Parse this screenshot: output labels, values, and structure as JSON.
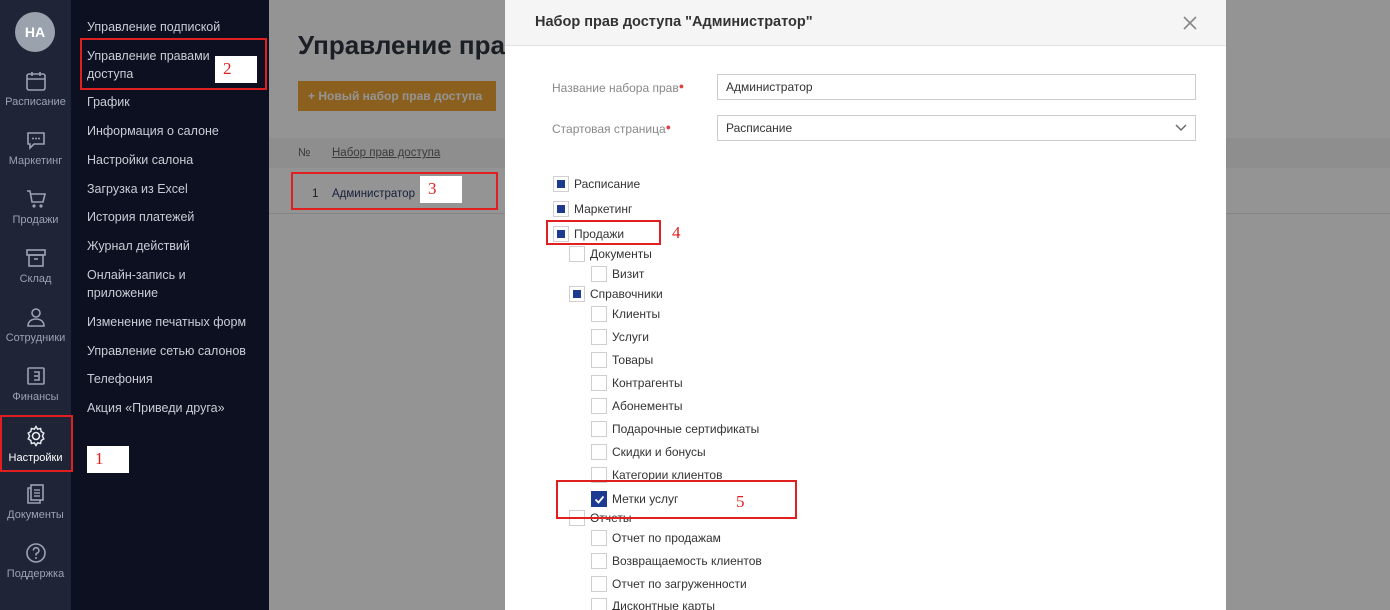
{
  "rail": {
    "avatar": "НА",
    "items": [
      {
        "label": "Расписание",
        "icon": "calendar-icon"
      },
      {
        "label": "Маркетинг",
        "icon": "chat-icon"
      },
      {
        "label": "Продажи",
        "icon": "cart-icon"
      },
      {
        "label": "Склад",
        "icon": "box-icon"
      },
      {
        "label": "Сотрудники",
        "icon": "person-icon"
      },
      {
        "label": "Финансы",
        "icon": "wallet-icon"
      },
      {
        "label": "Настройки",
        "icon": "gear-icon"
      },
      {
        "label": "Документы",
        "icon": "documents-icon"
      },
      {
        "label": "Поддержка",
        "icon": "help-icon"
      }
    ]
  },
  "submenu": {
    "items": [
      "Управление подпиской",
      "Управление правами доступа",
      "График",
      "Информация о салоне",
      "Настройки салона",
      "Загрузка из Excel",
      "История платежей",
      "Журнал действий",
      "Онлайн-запись и приложение",
      "Изменение печатных форм",
      "Управление сетью салонов",
      "Телефония",
      "Акция «Приведи друга»"
    ]
  },
  "page": {
    "title": "Управление прав",
    "new_button": "+ Новый набор прав доступа",
    "table": {
      "headers": [
        "№",
        "Набор прав доступа"
      ],
      "rows": [
        [
          "1",
          "Администратор"
        ]
      ]
    }
  },
  "modal": {
    "title": "Набор прав доступа \"Администратор\"",
    "name_label": "Название набора прав",
    "name_value": "Администратор",
    "start_label": "Стартовая страница",
    "start_value": "Расписание",
    "permissions": [
      {
        "label": "Расписание",
        "state": "partial"
      },
      {
        "label": "Маркетинг",
        "state": "partial"
      },
      {
        "label": "Продажи",
        "state": "partial"
      },
      {
        "label": "Документы",
        "state": "empty"
      },
      {
        "label": "Визит",
        "state": "empty"
      },
      {
        "label": "Справочники",
        "state": "partial"
      },
      {
        "label": "Клиенты",
        "state": "empty"
      },
      {
        "label": "Услуги",
        "state": "empty"
      },
      {
        "label": "Товары",
        "state": "empty"
      },
      {
        "label": "Контрагенты",
        "state": "empty"
      },
      {
        "label": "Абонементы",
        "state": "empty"
      },
      {
        "label": "Подарочные сертификаты",
        "state": "empty"
      },
      {
        "label": "Скидки и бонусы",
        "state": "empty"
      },
      {
        "label": "Категории клиентов",
        "state": "empty"
      },
      {
        "label": "Метки услуг",
        "state": "checked"
      },
      {
        "label": "Отчеты",
        "state": "empty"
      },
      {
        "label": "Отчет по продажам",
        "state": "empty"
      },
      {
        "label": "Возвращаемость клиентов",
        "state": "empty"
      },
      {
        "label": "Отчет по загруженности",
        "state": "empty"
      },
      {
        "label": "Дисконтные карты",
        "state": "empty"
      }
    ]
  },
  "annotations": [
    "1",
    "2",
    "3",
    "4",
    "5"
  ],
  "colors": {
    "annotation": "#e02020",
    "checkbox": "#1c3a8f",
    "button": "#f0a535",
    "rail": "#1f2436"
  }
}
